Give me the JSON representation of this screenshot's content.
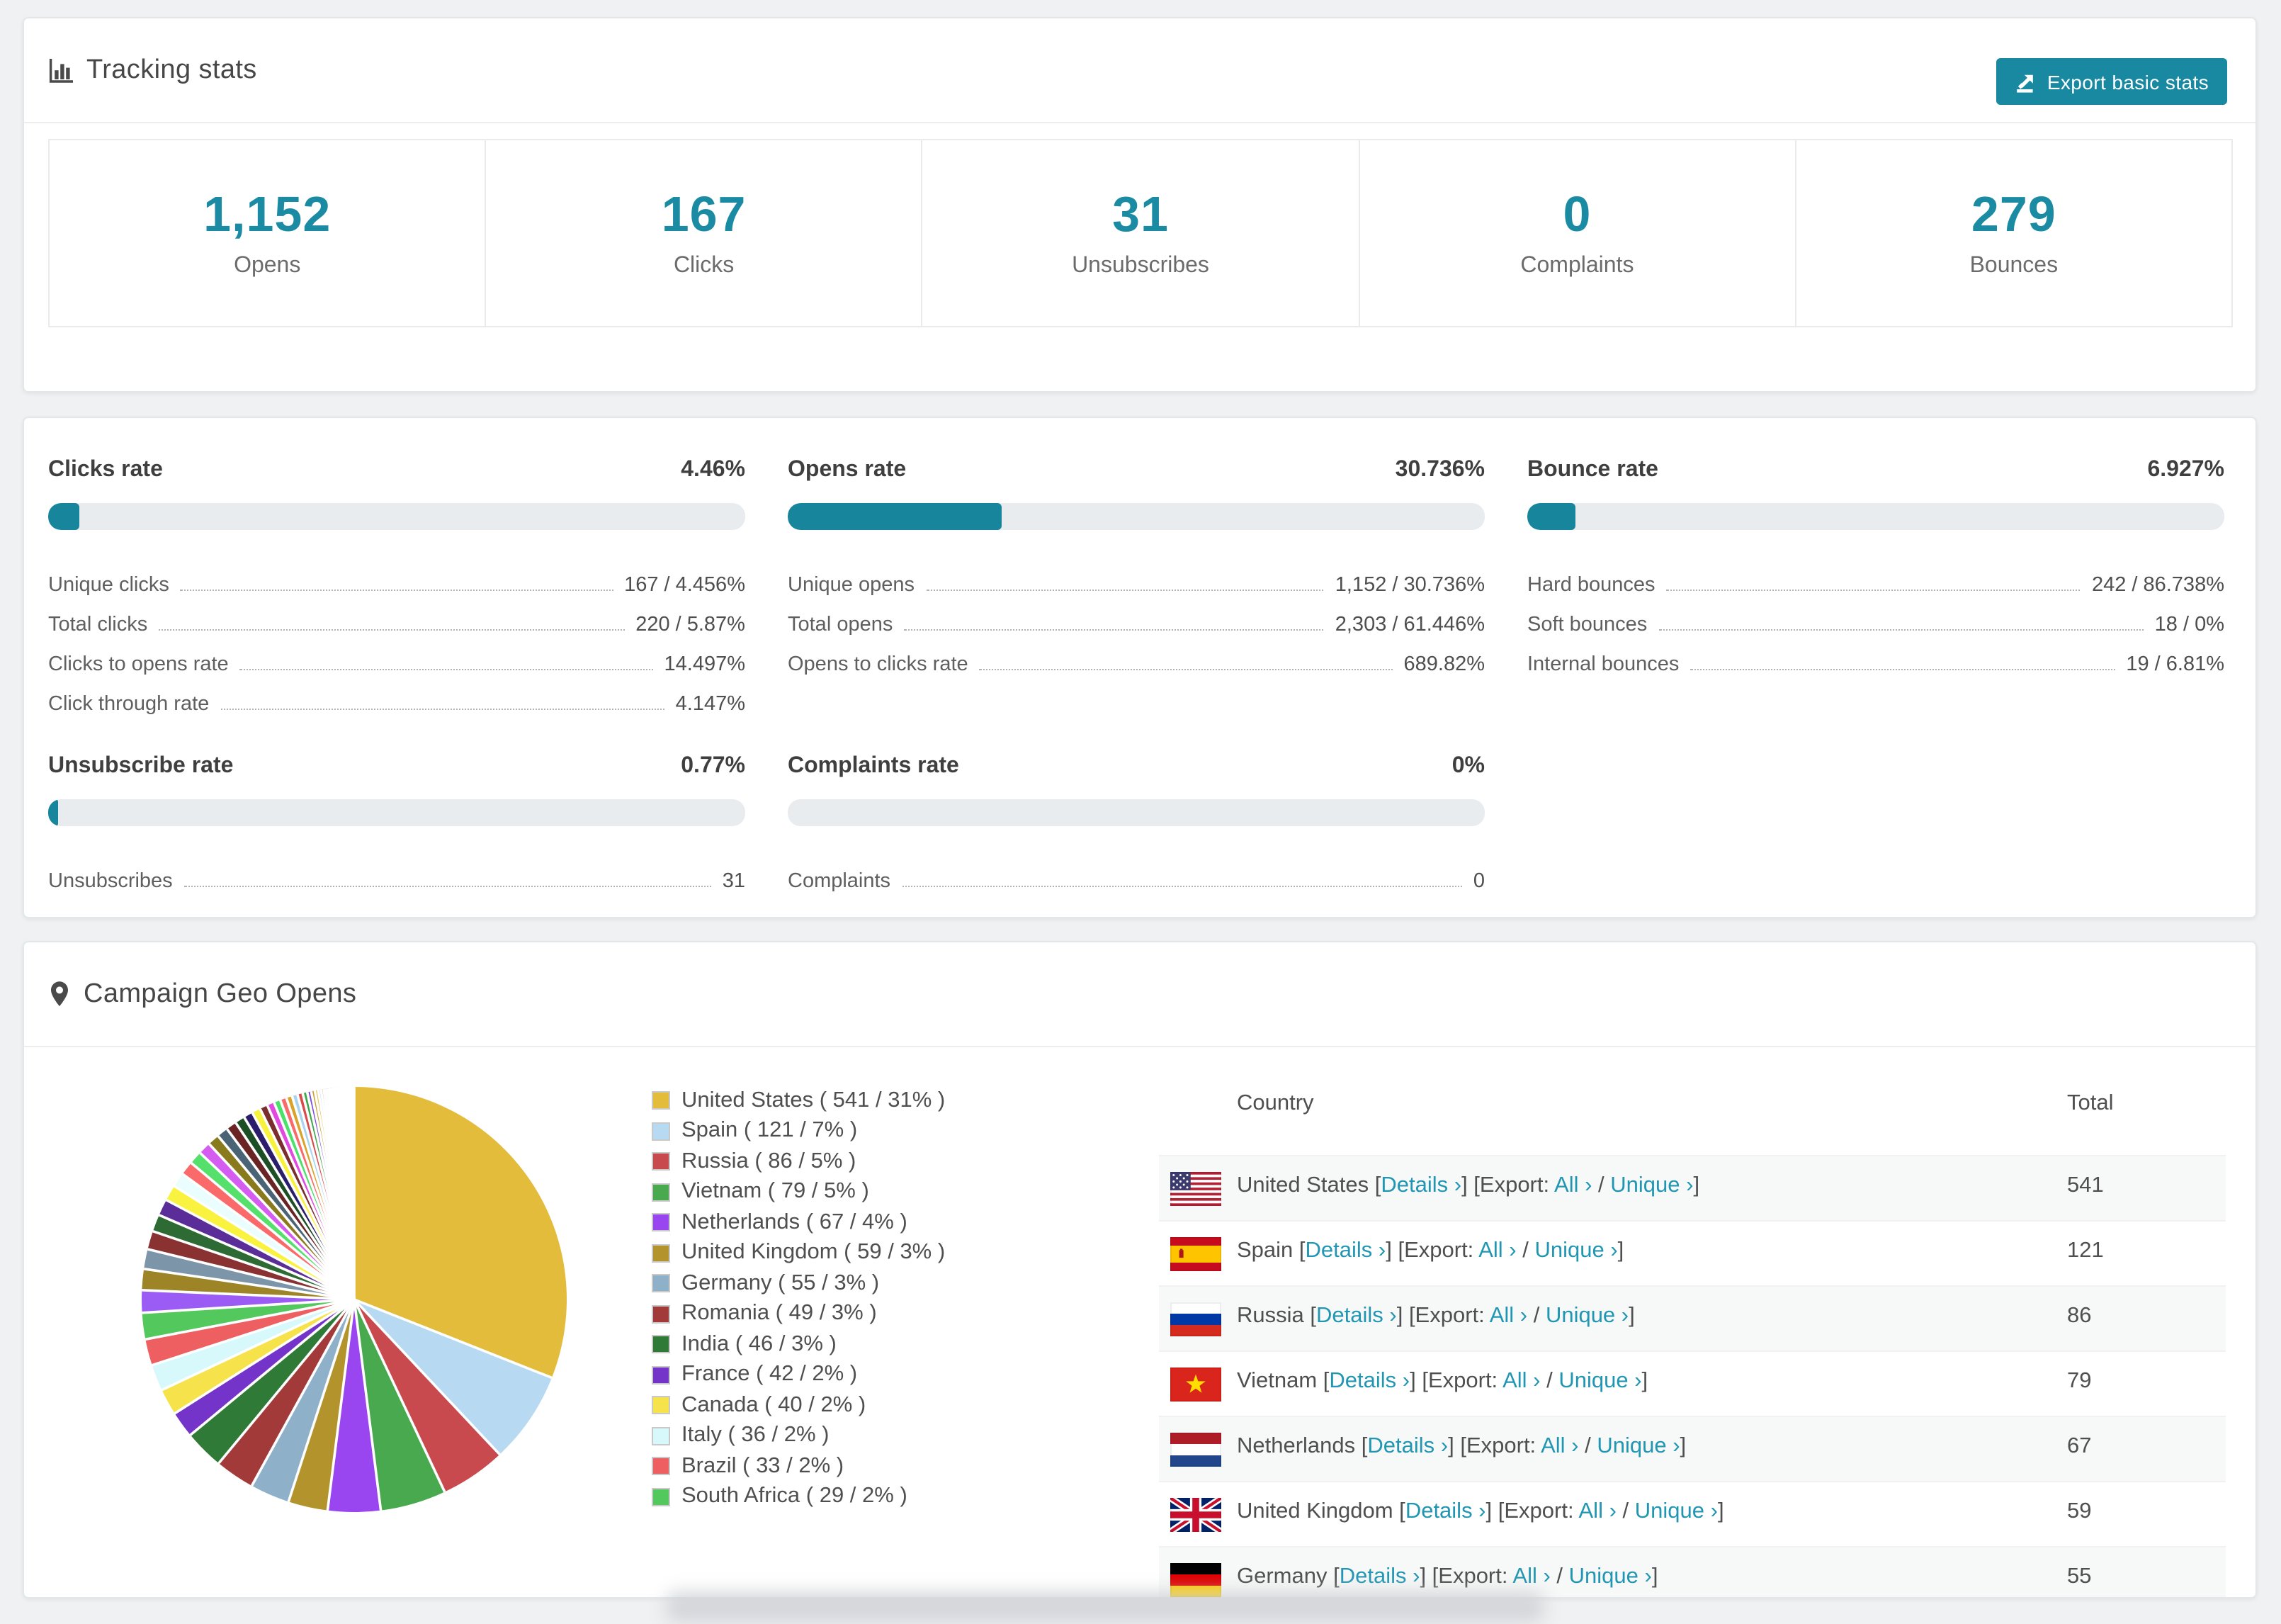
{
  "page": {
    "background": "#f0f1f2",
    "accent_teal": "#1889a1",
    "link_teal": "#2196b3"
  },
  "tracking": {
    "title": "Tracking stats",
    "export_button": "Export basic stats",
    "summary": [
      {
        "value": "1,152",
        "label": "Opens"
      },
      {
        "value": "167",
        "label": "Clicks"
      },
      {
        "value": "31",
        "label": "Unsubscribes"
      },
      {
        "value": "0",
        "label": "Complaints"
      },
      {
        "value": "279",
        "label": "Bounces"
      }
    ]
  },
  "rates": {
    "blocks": [
      {
        "title": "Clicks rate",
        "value": "4.46%",
        "percent": 4.46,
        "rows": [
          {
            "label": "Unique clicks",
            "value": "167 / 4.456%"
          },
          {
            "label": "Total clicks",
            "value": "220 / 5.87%"
          },
          {
            "label": "Clicks to opens rate",
            "value": "14.497%"
          },
          {
            "label": "Click through rate",
            "value": "4.147%"
          }
        ]
      },
      {
        "title": "Opens rate",
        "value": "30.736%",
        "percent": 30.736,
        "rows": [
          {
            "label": "Unique opens",
            "value": "1,152 / 30.736%"
          },
          {
            "label": "Total opens",
            "value": "2,303 / 61.446%"
          },
          {
            "label": "Opens to clicks rate",
            "value": "689.82%"
          }
        ]
      },
      {
        "title": "Bounce rate",
        "value": "6.927%",
        "percent": 6.927,
        "rows": [
          {
            "label": "Hard bounces",
            "value": "242 / 86.738%"
          },
          {
            "label": "Soft bounces",
            "value": "18 / 0%"
          },
          {
            "label": "Internal bounces",
            "value": "19 / 6.81%"
          }
        ]
      },
      {
        "title": "Unsubscribe rate",
        "value": "0.77%",
        "percent": 0.77,
        "rows": [
          {
            "label": "Unsubscribes",
            "value": "31"
          }
        ]
      },
      {
        "title": "Complaints rate",
        "value": "0%",
        "percent": 0,
        "rows": [
          {
            "label": "Complaints",
            "value": "0"
          }
        ]
      }
    ]
  },
  "geo": {
    "title": "Campaign Geo Opens",
    "legend": [
      {
        "label": "United States ( 541 / 31% )",
        "color": "#e3bc3c"
      },
      {
        "label": "Spain ( 121 / 7% )",
        "color": "#b7d9f1"
      },
      {
        "label": "Russia ( 86 / 5% )",
        "color": "#c94a4e"
      },
      {
        "label": "Vietnam ( 79 / 5% )",
        "color": "#49a94f"
      },
      {
        "label": "Netherlands ( 67 / 4% )",
        "color": "#9a46f0"
      },
      {
        "label": "United Kingdom ( 59 / 3% )",
        "color": "#b3932c"
      },
      {
        "label": "Germany ( 55 / 3% )",
        "color": "#8fb0c9"
      },
      {
        "label": "Romania ( 49 / 3% )",
        "color": "#a33a3a"
      },
      {
        "label": "India ( 46 / 3% )",
        "color": "#2f7a36"
      },
      {
        "label": "France ( 42 / 2% )",
        "color": "#7433c9"
      },
      {
        "label": "Canada ( 40 / 2% )",
        "color": "#f6e24b"
      },
      {
        "label": "Italy ( 36 / 2% )",
        "color": "#d8f9fb"
      },
      {
        "label": "Brazil ( 33 / 2% )",
        "color": "#ee5f62"
      },
      {
        "label": "South Africa ( 29 / 2% )",
        "color": "#53c85d"
      }
    ],
    "table": {
      "columns": [
        "Country",
        "Total"
      ],
      "link_parts": {
        "details": "Details ›",
        "export": "Export:",
        "all": "All ›",
        "slash": "/",
        "unique": "Unique ›"
      },
      "rows": [
        {
          "country": "United States",
          "flag": "us",
          "total": "541"
        },
        {
          "country": "Spain",
          "flag": "es",
          "total": "121"
        },
        {
          "country": "Russia",
          "flag": "ru",
          "total": "86"
        },
        {
          "country": "Vietnam",
          "flag": "vn",
          "total": "79"
        },
        {
          "country": "Netherlands",
          "flag": "nl",
          "total": "67"
        },
        {
          "country": "United Kingdom",
          "flag": "gb",
          "total": "59"
        },
        {
          "country": "Germany",
          "flag": "de",
          "total": "55"
        }
      ]
    },
    "chart_data": {
      "type": "pie",
      "title": "Campaign Geo Opens",
      "legend_position": "right",
      "labels": [
        "United States",
        "Spain",
        "Russia",
        "Vietnam",
        "Netherlands",
        "United Kingdom",
        "Germany",
        "Romania",
        "India",
        "France",
        "Canada",
        "Italy",
        "Brazil",
        "South Africa"
      ],
      "values": [
        541,
        121,
        86,
        79,
        67,
        59,
        55,
        49,
        46,
        42,
        40,
        36,
        33,
        29
      ],
      "percents": [
        31,
        7,
        5,
        5,
        4,
        3,
        3,
        3,
        3,
        2,
        2,
        2,
        2,
        2
      ],
      "colors": [
        "#e3bc3c",
        "#b7d9f1",
        "#c94a4e",
        "#49a94f",
        "#9a46f0",
        "#b3932c",
        "#8fb0c9",
        "#a33a3a",
        "#2f7a36",
        "#7433c9",
        "#f6e24b",
        "#d8f9fb",
        "#ee5f62",
        "#53c85d"
      ],
      "others": {
        "note": "remaining ~26% made of many small unlabeled countries",
        "percents": [
          1.7,
          1.6,
          1.5,
          1.4,
          1.3,
          1.25,
          1.2,
          1.1,
          1.05,
          1.0,
          0.95,
          0.9,
          0.85,
          0.8,
          0.75,
          0.7,
          0.65,
          0.6,
          0.55,
          0.5,
          0.48,
          0.45,
          0.42,
          0.4,
          0.35,
          0.3,
          0.28,
          0.25,
          0.22,
          0.2,
          0.18,
          0.15,
          0.13,
          0.12,
          0.1,
          0.09,
          0.08,
          0.07,
          0.06,
          0.05,
          0.05,
          0.04,
          0.04,
          0.03,
          0.03,
          0.02,
          0.02
        ],
        "colors": [
          "#9a5cf5",
          "#9c8427",
          "#7d95a8",
          "#8a3232",
          "#2e6b34",
          "#5a2d99",
          "#f9f23e",
          "#eafdff",
          "#fa6a6a",
          "#55e06b",
          "#d45cf0",
          "#8a7a1e",
          "#4a6475",
          "#6b2424",
          "#1d4f24",
          "#2a1d6b",
          "#f7f23e",
          "#7a2e2e",
          "#e04ae0",
          "#4ae06a",
          "#fa6a6a",
          "#d9a32a",
          "#a8d4f0",
          "#d94a4a",
          "#3da84a",
          "#7a4ae0",
          "#c79f2e",
          "#e3bc3c",
          "#b7d9f1",
          "#c94a4e",
          "#49a94f",
          "#9a46f0",
          "#f06a9a",
          "#4a90d9",
          "#8a5c2e",
          "#e06a2a",
          "#6bd9d9",
          "#b8e04a",
          "#d94a8a",
          "#5c8ae0",
          "#9a2ee0",
          "#e0c94a",
          "#4ae0c9",
          "#e04a4a",
          "#8ae04a",
          "#4a6ae0",
          "#e08a4a"
        ]
      }
    }
  }
}
